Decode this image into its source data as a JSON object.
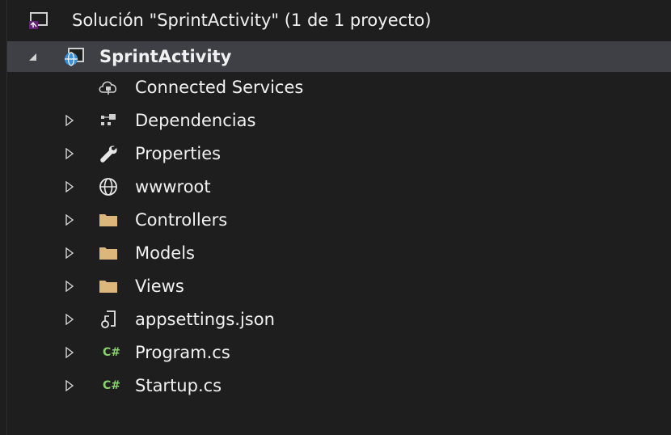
{
  "solution": {
    "label": "Solución \"SprintActivity\" (1 de 1 proyecto)",
    "icon": "solution-icon"
  },
  "project": {
    "label": "SprintActivity",
    "icon": "web-project-icon",
    "expanded": true
  },
  "items": [
    {
      "label": "Connected Services",
      "icon": "connected-services-icon",
      "expandable": false
    },
    {
      "label": "Dependencias",
      "icon": "dependencies-icon",
      "expandable": true
    },
    {
      "label": "Properties",
      "icon": "wrench-icon",
      "expandable": true
    },
    {
      "label": "wwwroot",
      "icon": "globe-icon",
      "expandable": true
    },
    {
      "label": "Controllers",
      "icon": "folder-icon",
      "expandable": true
    },
    {
      "label": "Models",
      "icon": "folder-icon",
      "expandable": true
    },
    {
      "label": "Views",
      "icon": "folder-icon",
      "expandable": true
    },
    {
      "label": "appsettings.json",
      "icon": "json-file-icon",
      "expandable": true
    },
    {
      "label": "Program.cs",
      "icon": "csharp-file-icon",
      "expandable": true,
      "badge": "C#"
    },
    {
      "label": "Startup.cs",
      "icon": "csharp-file-icon",
      "expandable": true,
      "badge": "C#"
    }
  ],
  "colors": {
    "background": "#1e1e1e",
    "selected": "#3f3f46",
    "folder": "#dcb67a",
    "csharp": "#8bd16f"
  }
}
